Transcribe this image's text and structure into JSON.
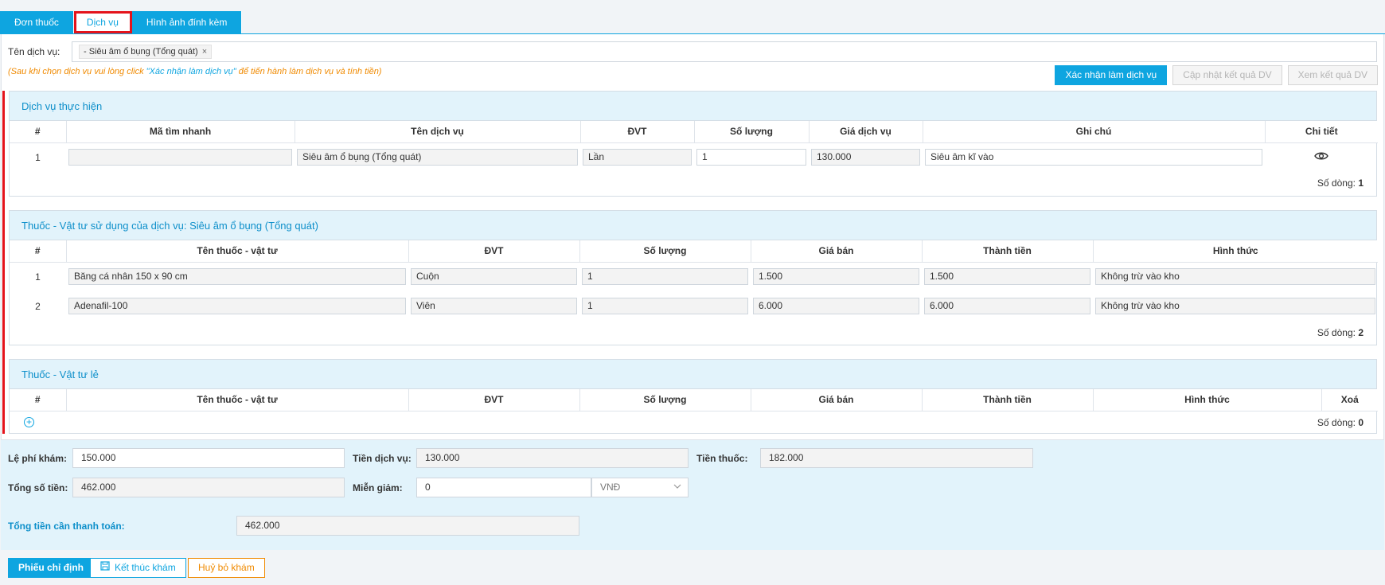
{
  "tabs": [
    "Đơn thuốc",
    "Dịch vụ",
    "Hình ảnh đính kèm"
  ],
  "service": {
    "label": "Tên dịch vụ:",
    "tag": "- Siêu âm ổ bụng (Tổng quát)",
    "tag_remove": "×"
  },
  "hint": {
    "prefix": "(Sau khi chọn dịch vụ vui lòng click ",
    "quote": "\"Xác nhận làm dịch vụ\"",
    "suffix": " để tiến hành làm dịch vụ và tính tiền)"
  },
  "top_buttons": {
    "confirm": "Xác nhận làm dịch vụ",
    "update": "Cập nhật kết quả DV",
    "view": "Xem kết quả DV"
  },
  "services_section": {
    "title": "Dịch vụ thực hiện",
    "columns": [
      "#",
      "Mã tìm nhanh",
      "Tên dịch vụ",
      "ĐVT",
      "Số lượng",
      "Giá dịch vụ",
      "Ghi chú",
      "Chi tiết"
    ],
    "rows": [
      {
        "index": "1",
        "code": "",
        "name": "Siêu âm ổ bụng (Tổng quát)",
        "unit": "Lần",
        "qty": "1",
        "price": "130.000",
        "note": "Siêu âm kĩ vào"
      }
    ],
    "row_count_label": "Số dòng:",
    "row_count": "1"
  },
  "materials_section": {
    "title": "Thuốc - Vật tư sử dụng của dịch vụ: Siêu âm ổ bụng (Tổng quát)",
    "columns": [
      "#",
      "Tên thuốc - vật tư",
      "ĐVT",
      "Số lượng",
      "Giá bán",
      "Thành tiền",
      "Hình thức"
    ],
    "rows": [
      {
        "index": "1",
        "name": "Băng cá nhân 150 x 90 cm",
        "unit": "Cuộn",
        "qty": "1",
        "price": "1.500",
        "total": "1.500",
        "method": "Không trừ vào kho"
      },
      {
        "index": "2",
        "name": "Adenafil-100",
        "unit": "Viên",
        "qty": "1",
        "price": "6.000",
        "total": "6.000",
        "method": "Không trừ vào kho"
      }
    ],
    "row_count_label": "Số dòng:",
    "row_count": "2"
  },
  "retail_section": {
    "title": "Thuốc - Vật tư lẻ",
    "columns": [
      "#",
      "Tên thuốc - vật tư",
      "ĐVT",
      "Số lượng",
      "Giá bán",
      "Thành tiền",
      "Hình thức",
      "Xoá"
    ],
    "row_count_label": "Số dòng:",
    "row_count": "0"
  },
  "totals": {
    "exam_fee_label": "Lệ phí khám:",
    "exam_fee": "150.000",
    "service_fee_label": "Tiền dịch vụ:",
    "service_fee": "130.000",
    "drug_fee_label": "Tiền thuốc:",
    "drug_fee": "182.000",
    "total_label": "Tổng số tiền:",
    "total": "462.000",
    "discount_label": "Miễn giảm:",
    "discount": "0",
    "currency": "VNĐ",
    "payable_label": "Tổng tiền cần thanh toán:",
    "payable": "462.000"
  },
  "bottom_buttons": {
    "referral": "Phiếu chỉ định",
    "finish": "Kết thúc khám",
    "cancel": "Huỷ bỏ khám"
  },
  "colors": {
    "primary": "#0ea5e0",
    "highlight": "#e4131b",
    "warning": "#f08a00",
    "section_bg": "#e2f3fb"
  }
}
